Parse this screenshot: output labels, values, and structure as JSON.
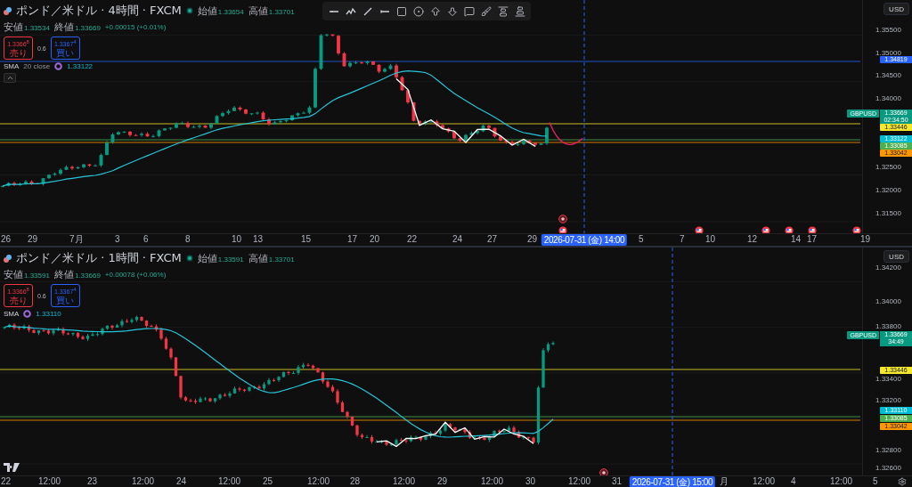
{
  "panes": [
    {
      "legend": {
        "symbol": "ポンド／米ドル · 4時間 · FXCM",
        "ohlc": [
          {
            "label": "始値",
            "value": "1.33654"
          },
          {
            "label": "高値",
            "value": "1.33701"
          },
          {
            "label": "安値",
            "value": "1.33534"
          },
          {
            "label": "終値",
            "value": "1.33669"
          }
        ],
        "change": "+0.00015 (+0.01%)",
        "sell": {
          "price": "1.3366$^{8}$",
          "label": "売り"
        },
        "spread": "0.6",
        "buy": {
          "price": "1.3367$^{4}$",
          "label": "買い"
        },
        "indicator": {
          "name": "SMA",
          "params": "20 close",
          "value": "1.33122"
        }
      },
      "currency": "USD",
      "price_ticks": [
        "1.35500",
        "1.35000",
        "1.34500",
        "1.34000",
        "1.32500",
        "1.32000",
        "1.31500"
      ],
      "price_tags": [
        {
          "kind": "level",
          "price": "1.34819",
          "color": "#2962ff"
        },
        {
          "kind": "symbol",
          "symbol": "GBPUSD",
          "price": "1.33669",
          "countdown": "02:34:50",
          "color": "#089981"
        },
        {
          "kind": "level",
          "price": "1.33446",
          "color": "#f5e72b"
        },
        {
          "kind": "indicator",
          "price": "1.33122",
          "color": "#00bcd4"
        },
        {
          "kind": "level",
          "price": "1.33085",
          "color": "#4caf50"
        },
        {
          "kind": "level",
          "price": "1.33042",
          "color": "#ff9800"
        }
      ],
      "time_ticks": [
        "26",
        "29",
        "7月",
        "3",
        "6",
        "8",
        "10",
        "13",
        "15",
        "17",
        "20",
        "22",
        "24",
        "27",
        "29",
        "5",
        "7",
        "10",
        "12",
        "14",
        "17",
        "19"
      ],
      "crosshair_time": "2026-07-31 (金) 14:00"
    },
    {
      "legend": {
        "symbol": "ポンド／米ドル · 1時間 · FXCM",
        "ohlc": [
          {
            "label": "始値",
            "value": "1.33591"
          },
          {
            "label": "高値",
            "value": "1.33701"
          },
          {
            "label": "安値",
            "value": "1.33591"
          },
          {
            "label": "終値",
            "value": "1.33669"
          }
        ],
        "change": "+0.00078 (+0.06%)",
        "sell": {
          "price": "1.3366$^{8}$",
          "label": "売り"
        },
        "spread": "0.6",
        "buy": {
          "price": "1.3367$^{4}$",
          "label": "買い"
        },
        "indicator": {
          "name": "SMA",
          "value": "1.33110"
        }
      },
      "currency": "USD",
      "price_ticks": [
        "1.34200",
        "1.34000",
        "1.33800",
        "1.33400",
        "1.33200",
        "1.32800",
        "1.32600"
      ],
      "price_tags": [
        {
          "kind": "symbol",
          "symbol": "GBPUSD",
          "price": "1.33669",
          "countdown": "34:49",
          "color": "#089981"
        },
        {
          "kind": "level",
          "price": "1.33446",
          "color": "#f5e72b"
        },
        {
          "kind": "indicator",
          "price": "1.33110",
          "color": "#00bcd4"
        },
        {
          "kind": "level",
          "price": "1.33085",
          "color": "#4caf50"
        },
        {
          "kind": "level",
          "price": "1.33042",
          "color": "#ff9800"
        }
      ],
      "time_ticks": [
        "22",
        "12:00",
        "23",
        "12:00",
        "24",
        "12:00",
        "25",
        "12:00",
        "28",
        "12:00",
        "29",
        "12:00",
        "30",
        "12:00",
        "31",
        "月",
        "12:00",
        "4",
        "12:00",
        "5"
      ],
      "crosshair_time": "2026-07-31 (金) 15:00"
    }
  ]
}
